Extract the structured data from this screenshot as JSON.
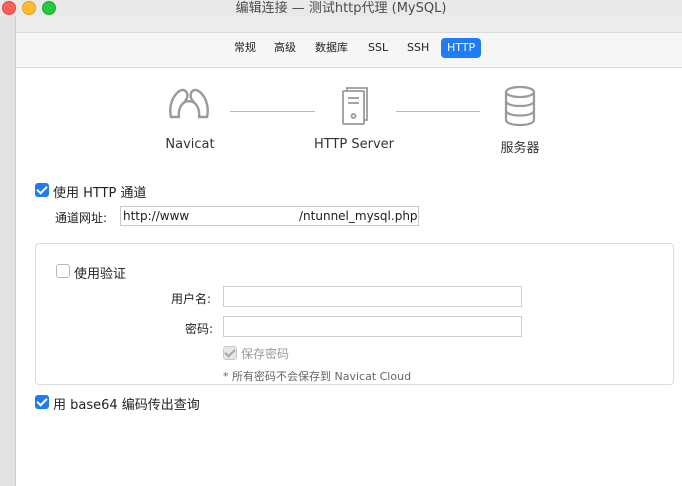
{
  "window": {
    "title": "编辑连接 — 测试http代理 (MySQL)"
  },
  "tabs": [
    {
      "label": "常规",
      "active": false
    },
    {
      "label": "高级",
      "active": false
    },
    {
      "label": "数据库",
      "active": false
    },
    {
      "label": "SSL",
      "active": false
    },
    {
      "label": "SSH",
      "active": false
    },
    {
      "label": "HTTP",
      "active": true
    }
  ],
  "diagram": {
    "nodes": [
      {
        "label": "Navicat",
        "icon": "navicat-logo-icon"
      },
      {
        "label": "HTTP Server",
        "icon": "server-icon"
      },
      {
        "label": "服务器",
        "icon": "database-icon"
      }
    ]
  },
  "http_tunnel": {
    "use_label": "使用 HTTP 通道",
    "use_checked": true,
    "url_label": "通道网址:",
    "url_value_start": "http://www",
    "url_value_end": "/ntunnel_mysql.php"
  },
  "auth": {
    "use_label": "使用验证",
    "use_checked": false,
    "username_label": "用户名:",
    "username_value": "",
    "password_label": "密码:",
    "password_value": "",
    "save_password_label": "保存密码",
    "save_password_checked": true,
    "note": "* 所有密码不会保存到 Navicat Cloud"
  },
  "base64": {
    "label": "用 base64 编码传出查询",
    "checked": true
  },
  "colors": {
    "accent": "#1f7bf6",
    "connector": "#b8b8b8",
    "icon": "#9a9a9a"
  }
}
